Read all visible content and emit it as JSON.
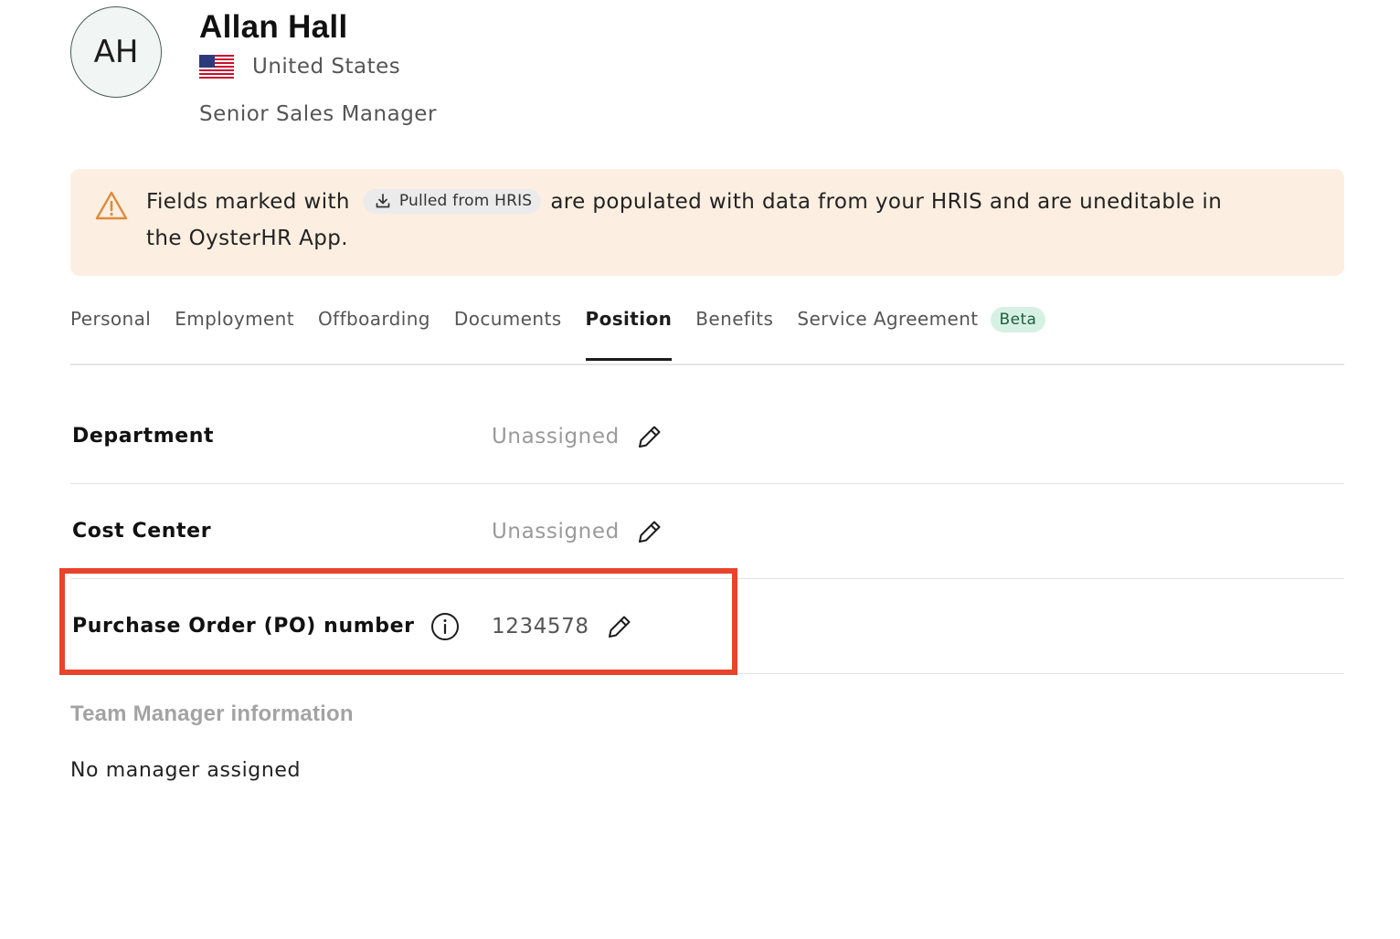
{
  "profile": {
    "initials": "AH",
    "name": "Allan Hall",
    "country": "United States",
    "flag_icon": "us-flag-icon",
    "job_title": "Senior Sales Manager"
  },
  "banner": {
    "icon": "warning-icon",
    "text_before": "Fields marked with",
    "chip_label": "Pulled from HRIS",
    "chip_icon": "download-icon",
    "text_after": "are populated with data from your HRIS and are uneditable in",
    "text_line2": "the OysterHR App.",
    "background": "#fcefe1",
    "icon_color": "#e08a3c"
  },
  "tabs": [
    {
      "label": "Personal"
    },
    {
      "label": "Employment"
    },
    {
      "label": "Offboarding"
    },
    {
      "label": "Documents"
    },
    {
      "label": "Position",
      "active": true
    },
    {
      "label": "Benefits"
    },
    {
      "label": "Service Agreement",
      "badge": "Beta"
    }
  ],
  "fields": {
    "department": {
      "label": "Department",
      "value": "Unassigned"
    },
    "cost_center": {
      "label": "Cost Center",
      "value": "Unassigned"
    },
    "po_number": {
      "label": "Purchase Order (PO) number",
      "value": "1234578"
    }
  },
  "team_manager": {
    "heading": "Team Manager information",
    "empty_text": "No manager assigned"
  },
  "colors": {
    "highlight": "#e8432b",
    "beta_badge_bg": "#d6f1e3",
    "beta_badge_text": "#1f5e40"
  }
}
